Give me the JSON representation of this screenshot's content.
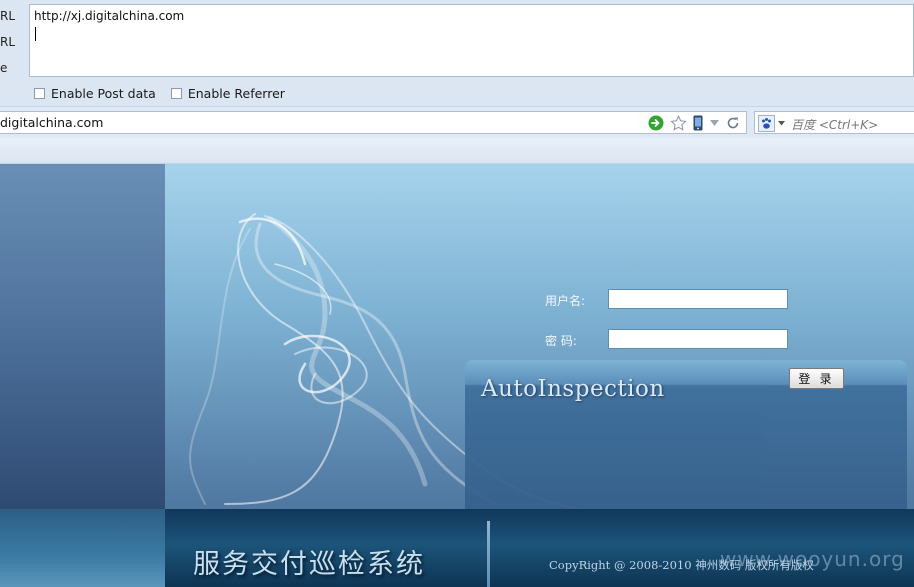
{
  "hackbar": {
    "labels": [
      "RL",
      "RL",
      "e"
    ],
    "url_value": "http://xj.digitalchina.com",
    "options": [
      "Enable Post data",
      "Enable Referrer"
    ]
  },
  "browser": {
    "address": "digitalchina.com",
    "search_engine_icon": "baidu-paw-icon",
    "search_placeholder": "百度 <Ctrl+K>"
  },
  "login": {
    "app_title": "AutoInspection",
    "username_label": "用户名:",
    "password_label": "密 码:",
    "username_value": "",
    "password_value": "",
    "submit_label": "登 录"
  },
  "footer": {
    "brand": "服务交付巡检系统",
    "copyright": "CopyRight @ 2008-2010 神州数码 版权所有版权",
    "watermark": "www.wooyun.org"
  },
  "colors": {
    "page_top": "#a6d3ec",
    "page_bottom": "#3f6690",
    "footer": "#1c5479",
    "go_button": "#2fa52f"
  }
}
